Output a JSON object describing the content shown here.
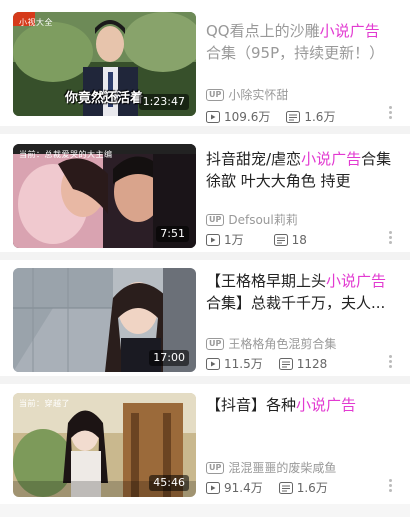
{
  "videos": [
    {
      "title_pre": "QQ看点上的沙雕",
      "title_hl": "小说广告",
      "title_post": "合集（95P，持续更新！）",
      "uploader": "小除实怀甜",
      "views": "109.6万",
      "comments": "1.6万",
      "duration": "1:23:47",
      "thumb_tag": "小视大全",
      "thumb_caption": "你竟然还活着"
    },
    {
      "title_pre": "抖音甜宠/虐恋",
      "title_hl": "小说广告",
      "title_post": "合集 徐歆 叶大大角色 持更",
      "uploader": "Defsoul莉莉",
      "views": "1万",
      "comments": "18",
      "duration": "7:51",
      "thumb_tag": "当前：总裁爱哭的大主编"
    },
    {
      "title_pre": "【王格格早期上头",
      "title_hl": "小说广告",
      "title_post": "合集】总裁千千万，夫人...",
      "uploader": "王格格角色混剪合集",
      "views": "11.5万",
      "comments": "1128",
      "duration": "17:00"
    },
    {
      "title_pre": "【抖音】各种",
      "title_hl": "小说广告",
      "title_post": "",
      "uploader": "混混噩噩的废柴咸鱼",
      "views": "91.4万",
      "comments": "1.6万",
      "duration": "45:46",
      "thumb_tag": "当前：穿越了"
    }
  ],
  "labels": {
    "up_badge": "UP"
  },
  "colors": {
    "highlight": "#e23ad1",
    "divider": "#f3f3f3"
  }
}
